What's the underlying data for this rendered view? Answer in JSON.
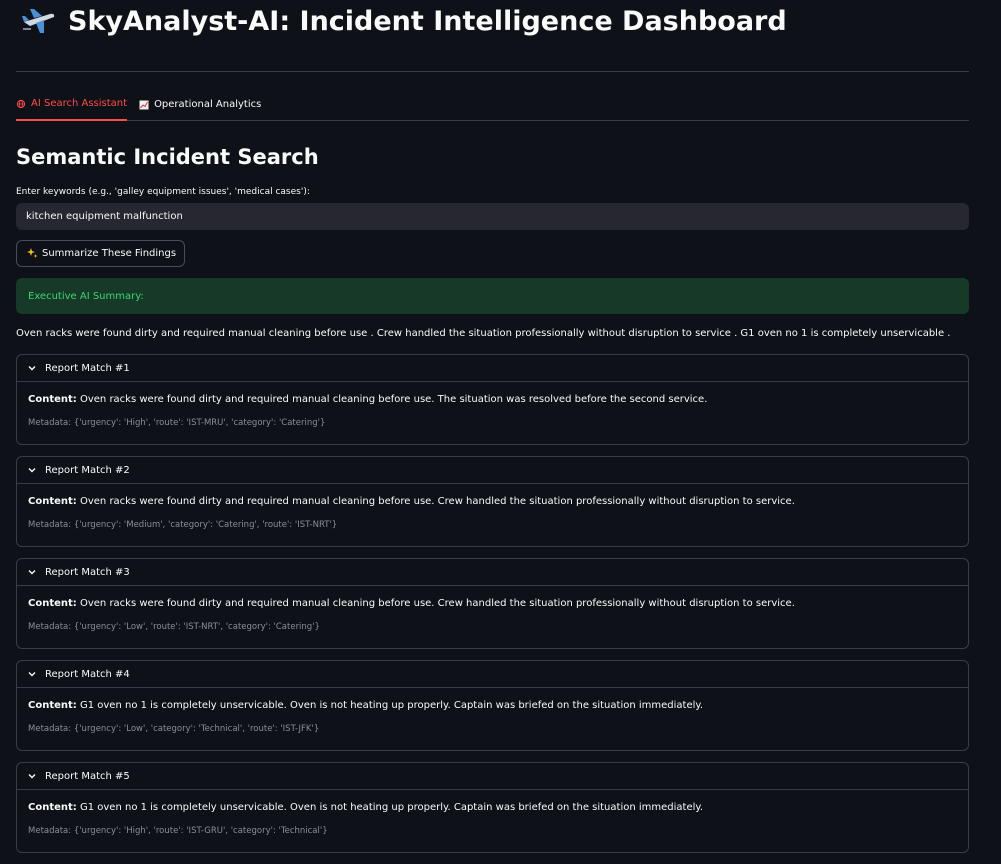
{
  "header": {
    "title": "SkyAnalyst-AI: Incident Intelligence Dashboard",
    "icon": "airplane-icon"
  },
  "tabs": [
    {
      "label": "AI Search Assistant",
      "icon": "globe-icon",
      "active": true
    },
    {
      "label": "Operational Analytics",
      "icon": "chart-icon",
      "active": false
    }
  ],
  "search": {
    "section_title": "Semantic Incident Search",
    "label": "Enter keywords (e.g., 'galley equipment issues', 'medical cases'):",
    "value": "kitchen equipment malfunction",
    "button_label": "Summarize These Findings",
    "button_icon": "sparkles-icon"
  },
  "summary": {
    "heading": "Executive AI Summary:",
    "text": "Oven racks were found dirty and required manual cleaning before use . Crew handled the situation professionally without disruption to service . G1 oven no 1 is completely unservicable ."
  },
  "colors": {
    "background": "#0e1117",
    "accent": "#ff4b4b",
    "success_bg": "#173928",
    "success_text": "#3dd56d"
  },
  "matches": [
    {
      "title": "Report Match #1",
      "content_label": "Content:",
      "content": "Oven racks were found dirty and required manual cleaning before use. The situation was resolved before the second service.",
      "metadata": "Metadata: {'urgency': 'High', 'route': 'IST-MRU', 'category': 'Catering'}"
    },
    {
      "title": "Report Match #2",
      "content_label": "Content:",
      "content": "Oven racks were found dirty and required manual cleaning before use. Crew handled the situation professionally without disruption to service.",
      "metadata": "Metadata: {'urgency': 'Medium', 'category': 'Catering', 'route': 'IST-NRT'}"
    },
    {
      "title": "Report Match #3",
      "content_label": "Content:",
      "content": "Oven racks were found dirty and required manual cleaning before use. Crew handled the situation professionally without disruption to service.",
      "metadata": "Metadata: {'urgency': 'Low', 'route': 'IST-NRT', 'category': 'Catering'}"
    },
    {
      "title": "Report Match #4",
      "content_label": "Content:",
      "content": "G1 oven no 1 is completely unservicable. Oven is not heating up properly. Captain was briefed on the situation immediately.",
      "metadata": "Metadata: {'urgency': 'Low', 'category': 'Technical', 'route': 'IST-JFK'}"
    },
    {
      "title": "Report Match #5",
      "content_label": "Content:",
      "content": "G1 oven no 1 is completely unservicable. Oven is not heating up properly. Captain was briefed on the situation immediately.",
      "metadata": "Metadata: {'urgency': 'High', 'route': 'IST-GRU', 'category': 'Technical'}"
    }
  ]
}
